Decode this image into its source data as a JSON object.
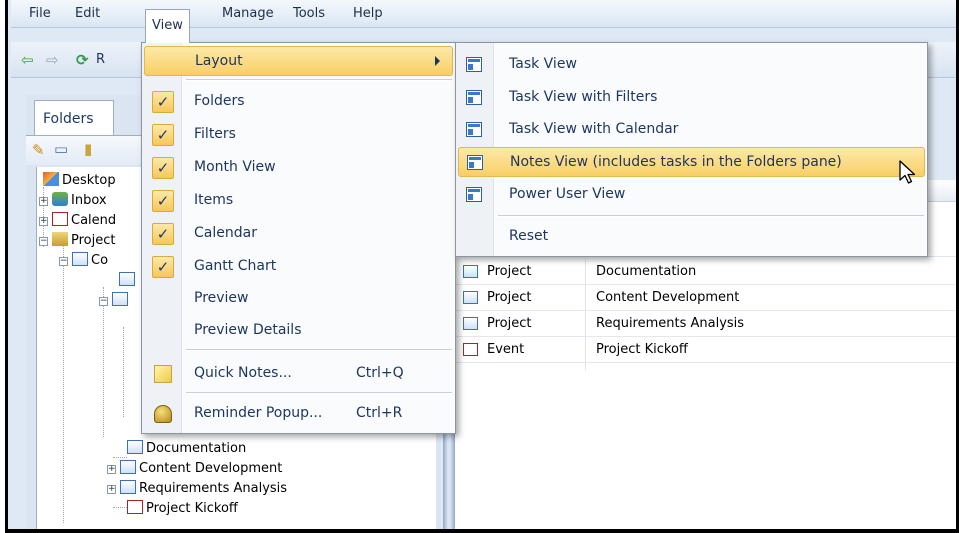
{
  "menubar": {
    "items": [
      {
        "label": "File"
      },
      {
        "label": "Edit"
      },
      {
        "label": "View"
      },
      {
        "label": "Manage"
      },
      {
        "label": "Tools"
      },
      {
        "label": "Help"
      }
    ],
    "active": "View"
  },
  "toolbar": {
    "refresh_label_partial": "R"
  },
  "folders": {
    "tab_label": "Folders",
    "tree": [
      {
        "label": "Desktop",
        "icon": "desktop-icon"
      },
      {
        "label": "Inbox",
        "icon": "inbox-icon"
      },
      {
        "label": "Calend",
        "icon": "calendar-icon"
      },
      {
        "label": "Project",
        "icon": "project-folder-icon"
      },
      {
        "label": "Co",
        "icon": "project-icon"
      },
      {
        "label": "Documentation",
        "icon": "project-icon"
      },
      {
        "label": "Content Development",
        "icon": "project-icon"
      },
      {
        "label": "Requirements Analysis",
        "icon": "project-icon"
      },
      {
        "label": "Project Kickoff",
        "icon": "event-icon"
      }
    ]
  },
  "view_menu": {
    "items": [
      {
        "label": "Layout",
        "has_submenu": true
      },
      {
        "label": "Folders",
        "checked": true
      },
      {
        "label": "Filters",
        "checked": true
      },
      {
        "label": "Month View",
        "checked": true
      },
      {
        "label": "Items",
        "checked": true
      },
      {
        "label": "Calendar",
        "checked": true
      },
      {
        "label": "Gantt Chart",
        "checked": true
      },
      {
        "label": "Preview",
        "checked": false
      },
      {
        "label": "Preview Details",
        "checked": false
      },
      {
        "label": "Quick Notes...",
        "shortcut": "Ctrl+Q",
        "icon": "sticky-note-icon"
      },
      {
        "label": "Reminder Popup...",
        "shortcut": "Ctrl+R",
        "icon": "bell-icon"
      }
    ],
    "check_glyph": "✓"
  },
  "layout_menu": {
    "items": [
      {
        "label": "Task View"
      },
      {
        "label": "Task View with Filters"
      },
      {
        "label": "Task View with Calendar"
      },
      {
        "label": "Notes View (includes tasks in the Folders pane)",
        "highlighted": true
      },
      {
        "label": "Power User View"
      },
      {
        "label": "Reset"
      }
    ]
  },
  "grid": {
    "rows": [
      {
        "type": "Project",
        "title": "Documentation",
        "icon": "project-icon"
      },
      {
        "type": "Project",
        "title": "Content Development",
        "icon": "project-icon"
      },
      {
        "type": "Project",
        "title": "Requirements Analysis",
        "icon": "project-icon"
      },
      {
        "type": "Event",
        "title": "Project Kickoff",
        "icon": "event-icon"
      }
    ]
  },
  "colors": {
    "menu_text": "#1d355e",
    "highlight": "#f8cf66",
    "frame_bg": "#dfe9f5"
  }
}
